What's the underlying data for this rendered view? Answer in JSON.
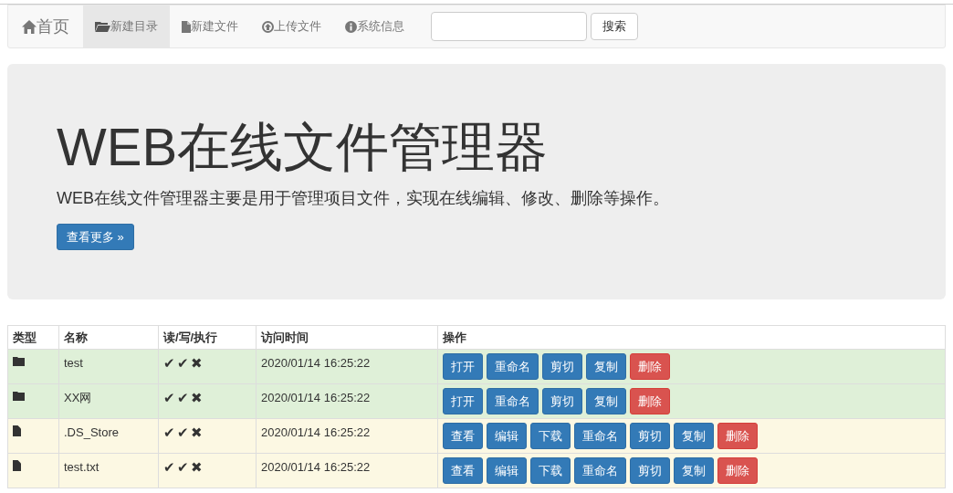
{
  "navbar": {
    "items": [
      {
        "label": "首页",
        "selected": false,
        "kind": "brand"
      },
      {
        "label": "新建目录",
        "selected": true,
        "kind": "link"
      },
      {
        "label": "新建文件",
        "selected": false,
        "kind": "link"
      },
      {
        "label": "上传文件",
        "selected": false,
        "kind": "link"
      },
      {
        "label": "系统信息",
        "selected": false,
        "kind": "link"
      }
    ],
    "search": {
      "button": "搜索"
    }
  },
  "jumbotron": {
    "title": "WEB在线文件管理器",
    "text": "WEB在线文件管理器主要是用于管理项目文件，实现在线编辑、修改、删除等操作。",
    "button": "查看更多 »"
  },
  "table": {
    "columns": [
      "类型",
      "名称",
      "读/写/执行",
      "访问时间",
      "操作"
    ],
    "rows": [
      {
        "kind": "folder",
        "name": "test",
        "permissions": [
          "✔",
          "✔",
          "✖"
        ],
        "time": "2020/01/14 16:25:22",
        "actions": [
          {
            "label": "打开",
            "kind": "primary"
          },
          {
            "label": "重命名",
            "kind": "primary"
          },
          {
            "label": "剪切",
            "kind": "primary"
          },
          {
            "label": "复制",
            "kind": "primary"
          },
          {
            "label": "删除",
            "kind": "danger"
          }
        ]
      },
      {
        "kind": "folder",
        "name": "XX网",
        "permissions": [
          "✔",
          "✔",
          "✖"
        ],
        "time": "2020/01/14 16:25:22",
        "actions": [
          {
            "label": "打开",
            "kind": "primary"
          },
          {
            "label": "重命名",
            "kind": "primary"
          },
          {
            "label": "剪切",
            "kind": "primary"
          },
          {
            "label": "复制",
            "kind": "primary"
          },
          {
            "label": "删除",
            "kind": "danger"
          }
        ]
      },
      {
        "kind": "file",
        "name": ".DS_Store",
        "permissions": [
          "✔",
          "✔",
          "✖"
        ],
        "time": "2020/01/14 16:25:22",
        "actions": [
          {
            "label": "查看",
            "kind": "primary"
          },
          {
            "label": "编辑",
            "kind": "primary"
          },
          {
            "label": "下载",
            "kind": "primary"
          },
          {
            "label": "重命名",
            "kind": "primary"
          },
          {
            "label": "剪切",
            "kind": "primary"
          },
          {
            "label": "复制",
            "kind": "primary"
          },
          {
            "label": "删除",
            "kind": "danger"
          }
        ]
      },
      {
        "kind": "file",
        "name": "test.txt",
        "permissions": [
          "✔",
          "✔",
          "✖"
        ],
        "time": "2020/01/14 16:25:22",
        "actions": [
          {
            "label": "查看",
            "kind": "primary"
          },
          {
            "label": "编辑",
            "kind": "primary"
          },
          {
            "label": "下载",
            "kind": "primary"
          },
          {
            "label": "重命名",
            "kind": "primary"
          },
          {
            "label": "剪切",
            "kind": "primary"
          },
          {
            "label": "复制",
            "kind": "primary"
          },
          {
            "label": "删除",
            "kind": "danger"
          }
        ]
      }
    ]
  }
}
